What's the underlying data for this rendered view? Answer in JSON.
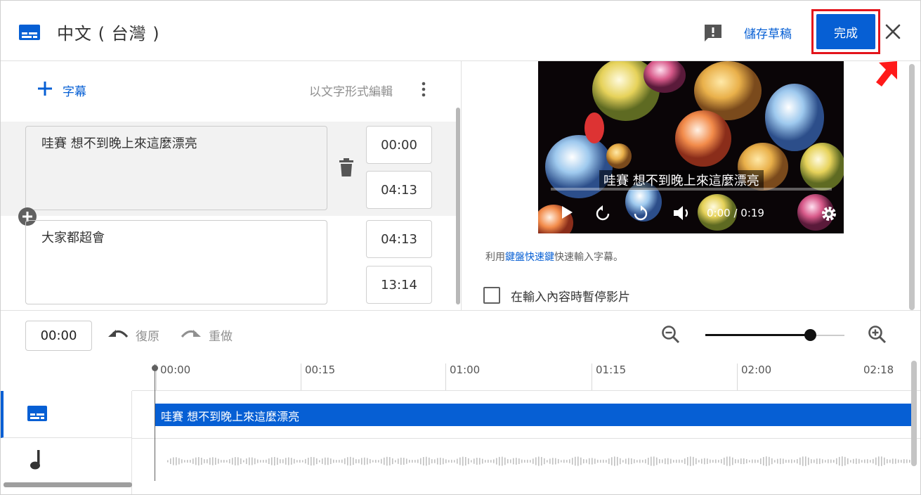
{
  "header": {
    "title": "中文 ( 台灣 )",
    "save_draft": "儲存草稿",
    "done": "完成",
    "icons": [
      "subtitles-icon",
      "feedback-icon",
      "close-icon"
    ]
  },
  "editor": {
    "add_caption": "字幕",
    "edit_as_text": "以文字形式編輯",
    "cues": [
      {
        "text": "哇賽 想不到晚上來這麼漂亮",
        "start": "00:00",
        "end": "04:13"
      },
      {
        "text": "大家都超會",
        "start": "04:13",
        "end": "13:14"
      }
    ]
  },
  "preview": {
    "caption": "哇賽 想不到晚上來這麼漂亮",
    "time": "0:00 / 0:19",
    "hint_prefix": "利用",
    "hint_link": "鍵盤快速鍵",
    "hint_suffix": "快速輸入字幕。",
    "pause_label": "在輸入內容時暫停影片",
    "pause_checked": false
  },
  "toolbar": {
    "current_time": "00:00",
    "undo": "復原",
    "redo": "重做",
    "zoom_level": 0.75
  },
  "timeline": {
    "ticks": [
      "00:00",
      "00:15",
      "01:00",
      "01:15",
      "02:00",
      "02:18"
    ],
    "caption_bar": "哇賽 想不到晚上來這麼漂亮"
  },
  "colors": {
    "accent": "#065fd4",
    "highlight": "#e3141b"
  }
}
